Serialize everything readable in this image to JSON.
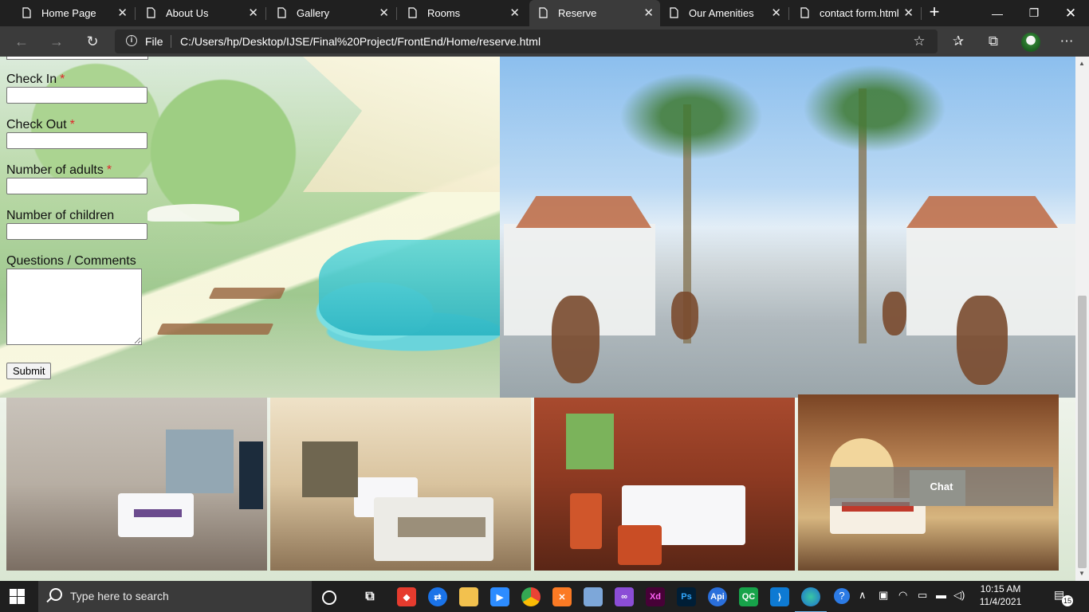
{
  "browser": {
    "tabs": [
      {
        "label": "Home Page",
        "active": false
      },
      {
        "label": "About Us",
        "active": false
      },
      {
        "label": "Gallery",
        "active": false
      },
      {
        "label": "Rooms",
        "active": false
      },
      {
        "label": "Reserve",
        "active": true
      },
      {
        "label": "Our Amenities",
        "active": false
      },
      {
        "label": "contact form.html",
        "active": false
      }
    ],
    "new_tab_icon": "plus-icon",
    "window_controls": [
      "minimize-icon",
      "restore-icon",
      "close-icon"
    ],
    "address": {
      "scheme_label": "File",
      "url": "C:/Users/hp/Desktop/IJSE/Final%20Project/FrontEnd/Home/reserve.html"
    },
    "toolbar_icons": [
      "add-favorite-icon",
      "favorites-icon",
      "collections-icon",
      "profile-avatar",
      "more-icon"
    ]
  },
  "page": {
    "form": {
      "fields": [
        {
          "label": "Check In",
          "required": true,
          "value": ""
        },
        {
          "label": "Check Out",
          "required": true,
          "value": ""
        },
        {
          "label": "Number of adults",
          "required": true,
          "value": ""
        },
        {
          "label": "Number of children",
          "required": false,
          "value": ""
        }
      ],
      "required_mark": "*",
      "comments_label": "Questions / Comments",
      "comments_value": "",
      "submit_label": "Submit"
    },
    "chat_label": "Chat"
  },
  "taskbar": {
    "search_placeholder": "Type here to search",
    "apps": [
      "task-view",
      "anydesk",
      "teamviewer",
      "file-explorer",
      "zoom",
      "chrome",
      "xampp",
      "virtualbox",
      "visual-studio",
      "adobe-xd",
      "photoshop",
      "api-tool",
      "qc",
      "vscode",
      "edge"
    ],
    "app_labels": {
      "xd": "Xd",
      "ps": "Ps",
      "qc": "QC",
      "api": "Api"
    },
    "time": "10:15 AM",
    "date": "11/4/2021",
    "notification_count": "15"
  },
  "colors": {
    "required": "#e0262b",
    "tabbar": "#202020",
    "toolbar": "#3b3b3b",
    "taskbar": "#1f1f1f"
  }
}
